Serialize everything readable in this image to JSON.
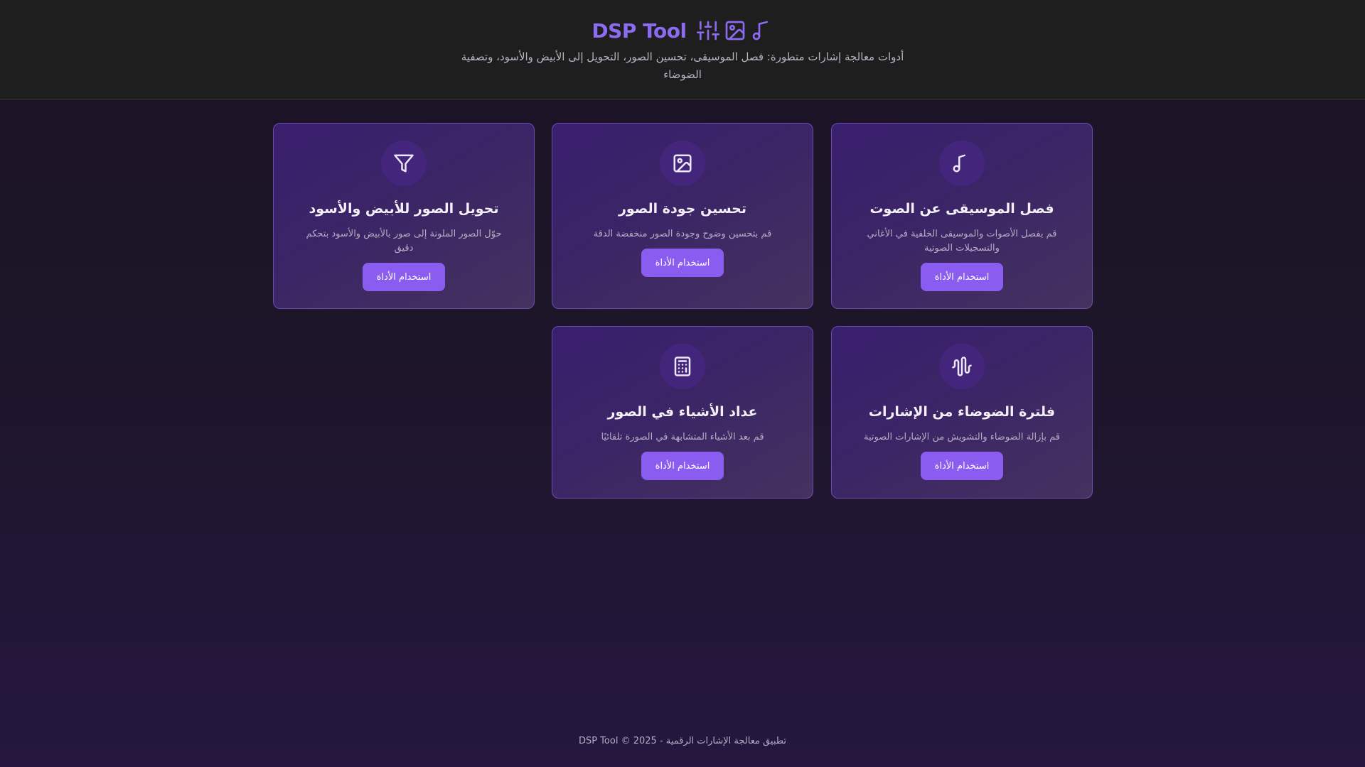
{
  "header": {
    "title": "DSP Tool",
    "subtitle": "أدوات معالجة إشارات متطورة: فصل الموسيقى، تحسين الصور، التحويل إلى الأبيض والأسود، وتصفية الضوضاء",
    "icons": [
      "sliders-icon",
      "image-icon",
      "music-note-icon"
    ]
  },
  "cards": [
    {
      "icon": "music-note-icon",
      "title": "فصل الموسيقى عن الصوت",
      "description": "قم بفصل الأصوات والموسيقى الخلفية في الأغاني والتسجيلات الصوتية",
      "button": "استخدام الأداة"
    },
    {
      "icon": "image-icon",
      "title": "تحسين جودة الصور",
      "description": "قم بتحسين وضوح وجودة الصور منخفضة الدقة",
      "button": "استخدام الأداة"
    },
    {
      "icon": "filter-icon",
      "title": "تحويل الصور للأبيض والأسود",
      "description": "حوّل الصور الملونة إلى صور بالأبيض والأسود بتحكم دقيق",
      "button": "استخدام الأداة"
    },
    {
      "icon": "audio-waveform-icon",
      "title": "فلترة الضوضاء من الإشارات",
      "description": "قم بإزالة الضوضاء والتشويش من الإشارات الصوتية",
      "button": "استخدام الأداة"
    },
    {
      "icon": "calculator-icon",
      "title": "عداد الأشياء في الصور",
      "description": "قم بعد الأشياء المتشابهة في الصورة تلقائيًا",
      "button": "استخدام الأداة"
    }
  ],
  "footer": {
    "text": "تطبيق معالجة الإشارات الرقمية - 2025 © DSP Tool"
  },
  "colors": {
    "accent": "#8b6cf0",
    "button": "#8a5cf0",
    "card_border": "#6a4bb1",
    "header_bg": "#1e1e1e"
  }
}
